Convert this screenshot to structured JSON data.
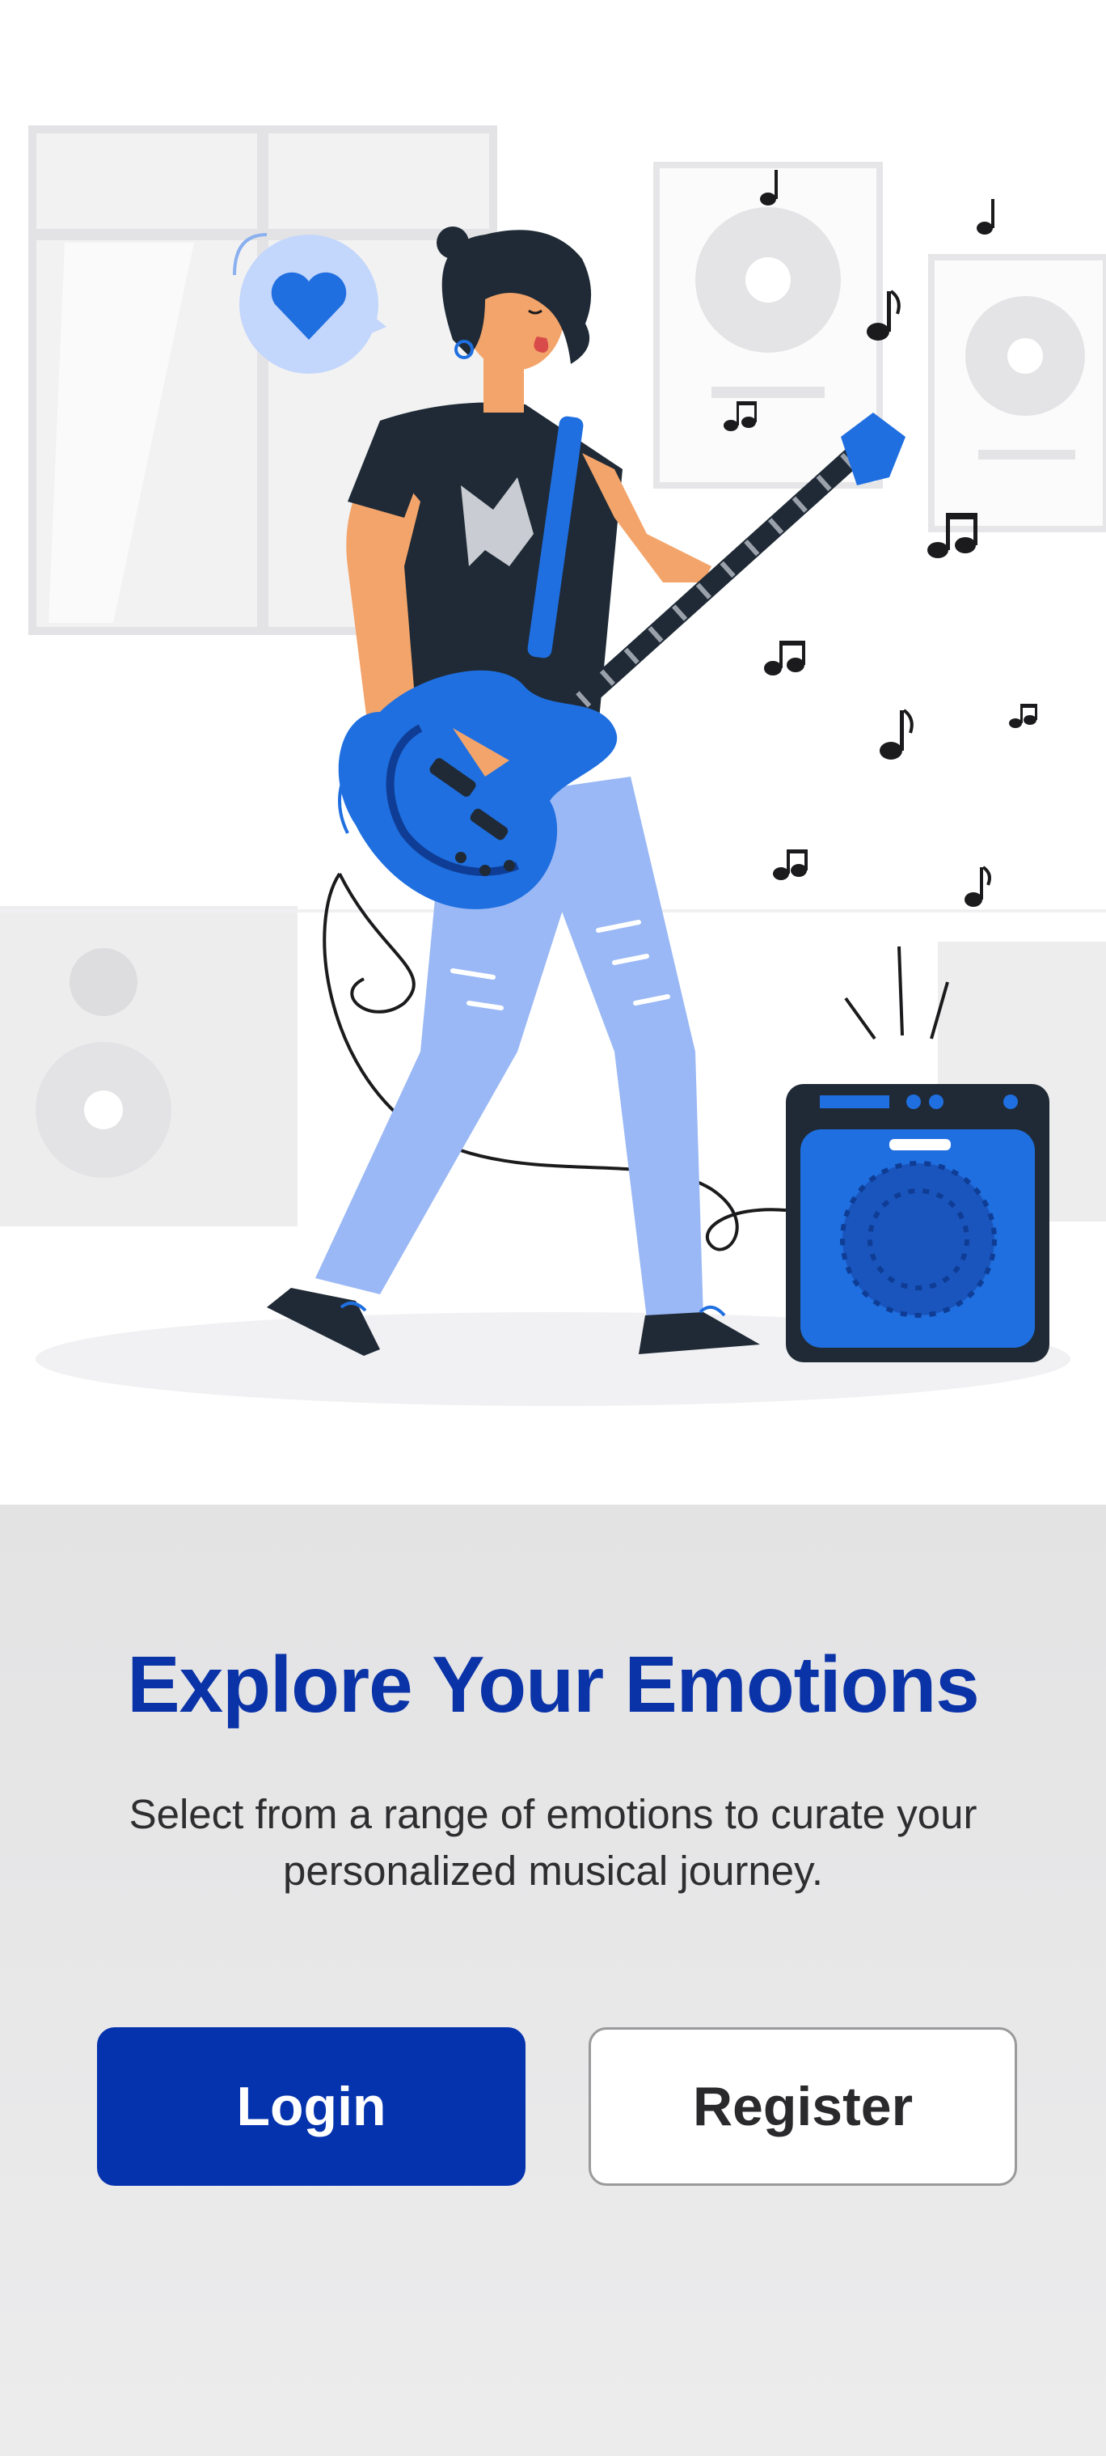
{
  "onboarding": {
    "title": "Explore Your Emotions",
    "subtitle": "Select from a range of emotions to curate your personalized musical journey.",
    "login_label": "Login",
    "register_label": "Register"
  },
  "illustration": {
    "subject": "guitarist-playing-electric-guitar-with-amplifier",
    "icons": [
      "heart-icon",
      "music-note-icon"
    ]
  },
  "colors": {
    "primary": "#0533ad",
    "title": "#0a33a8",
    "accent_blue": "#1f6fe0",
    "light_blue": "#9ab8f5",
    "background": "#e9e9ea"
  }
}
